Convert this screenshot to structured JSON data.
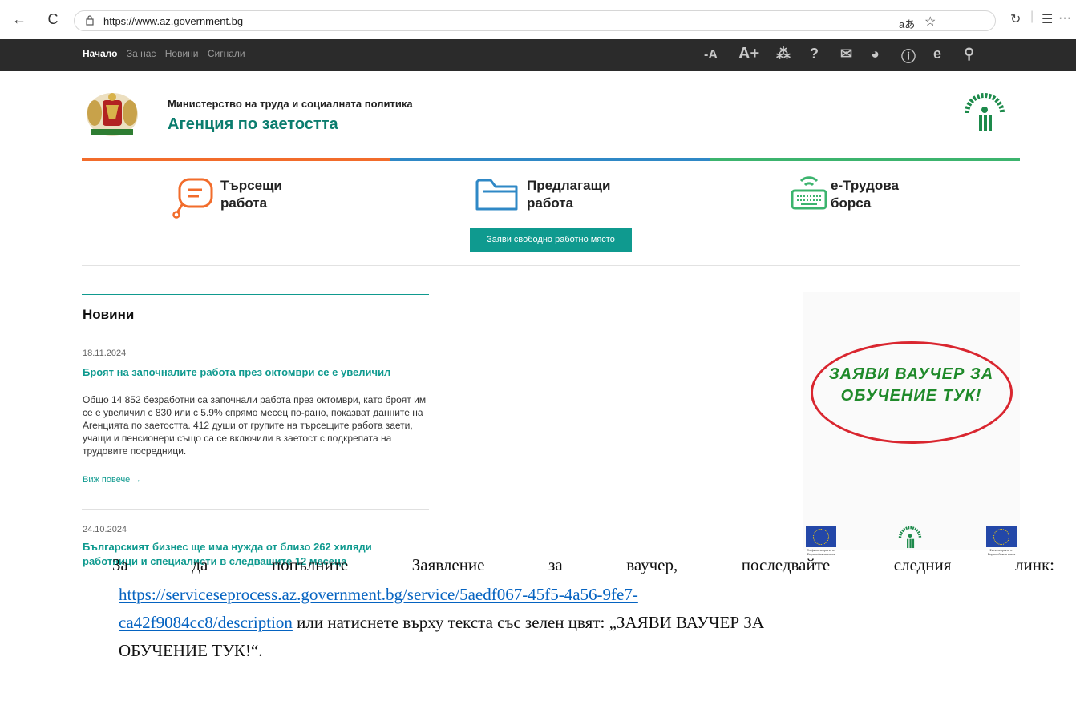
{
  "browser": {
    "url": "https://www.az.government.bg",
    "back_glyph": "←",
    "reload_glyph": "C",
    "reader_glyph": "aあ",
    "favorite_glyph": "☆",
    "ext_glyph": "↻",
    "favorites_glyph": "☰",
    "more_glyph": "···"
  },
  "topbar": {
    "nav": [
      "Начало",
      "За нас",
      "Новини",
      "Сигнали"
    ],
    "tools": {
      "font_minus": "-A",
      "font_plus": "A+",
      "sitemap": "⁂",
      "help": "?",
      "mail": "✉",
      "globe": "◕",
      "info": "ⓘ",
      "e": "e",
      "search": "⚲"
    }
  },
  "header": {
    "ministry": "Министерство на труда и социалната политика",
    "agency": "Агенция по заетостта"
  },
  "categories": [
    {
      "line1": "Търсещи",
      "line2": "работа",
      "icon": "chat-bubble-icon",
      "color": "#f26c2b"
    },
    {
      "line1": "Предлагащи",
      "line2": "работа",
      "icon": "folder-icon",
      "color": "#2f88c6"
    },
    {
      "line1": "е-Трудова",
      "line2": "борса",
      "icon": "keyboard-wifi-icon",
      "color": "#3cb46e"
    }
  ],
  "cta": "Заяви свободно работно място",
  "news": {
    "title": "Новини",
    "items": [
      {
        "date": "18.11.2024",
        "headline": "Броят на започналите работа през октомври се е увеличил",
        "body": "Общо 14 852 безработни са започнали работа през октомври, като броят им се е увеличил с 830 или с 5.9% спрямо месец по-рано, показват данните на Агенцията по заетостта. 412 души от групите на търсещите работа заети, учащи и пенсионери също са се включили в заетост с подкрепата на трудовите посредници.",
        "more": "Виж повече  →"
      },
      {
        "date": "24.10.2024",
        "headline": "Българският бизнес ще има нужда от близо 262 хиляди работници и специалисти в следващите 12 месеца"
      }
    ]
  },
  "banner": {
    "line1": "ЗАЯВИ ВАУЧЕР ЗА",
    "line2": "ОБУЧЕНИЕ ТУК!",
    "eu_caption_left": "Съфинансирано от Европейския съюз",
    "eu_caption_right": "Финансирано от Европейския съюз"
  },
  "doc": {
    "line1_words": [
      "За",
      "да",
      "попълните",
      "Заявление",
      "за",
      "ваучер,",
      "последвайте",
      "следния",
      "линк:"
    ],
    "link_part1": "https://serviceseprocess.az.government.bg/service/5aedf067-45f5-4a56-9fe7-",
    "link_part2": "ca42f9084cc8/description",
    "after_link": " или натиснете върху текста със зелен цвят: „ЗАЯВИ ВАУЧЕР ЗА",
    "line4": "ОБУЧЕНИЕ ТУК!“."
  }
}
